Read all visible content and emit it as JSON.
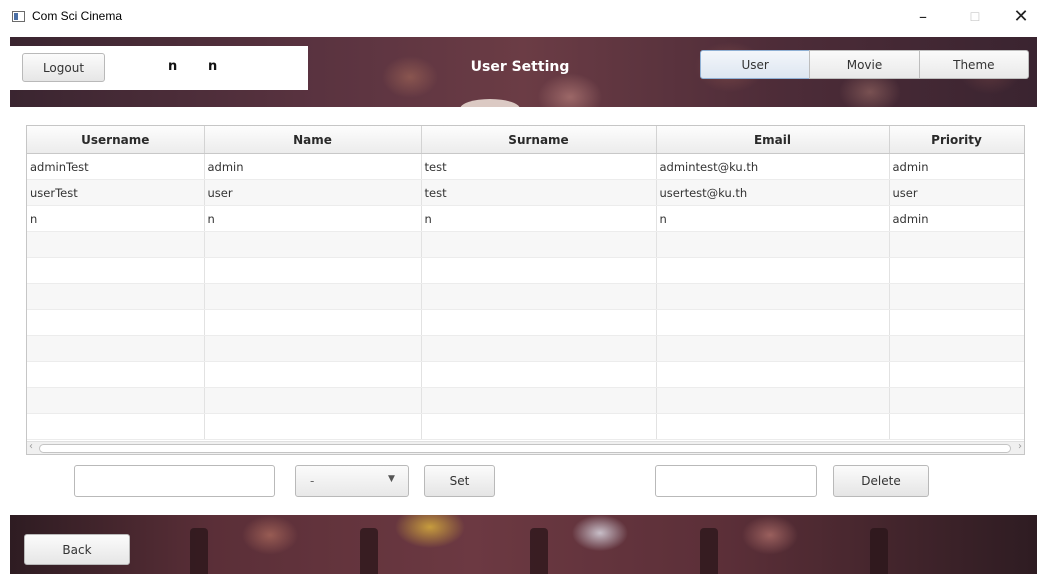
{
  "window": {
    "title": "Com Sci Cinema",
    "min_glyph": "–",
    "max_glyph": "☐",
    "close_glyph": "✕"
  },
  "header": {
    "logout_label": "Logout",
    "user_first": "n",
    "user_last": "n",
    "page_title": "User Setting",
    "tabs": [
      {
        "label": "User",
        "selected": true
      },
      {
        "label": "Movie",
        "selected": false
      },
      {
        "label": "Theme",
        "selected": false
      }
    ]
  },
  "table": {
    "columns": [
      "Username",
      "Name",
      "Surname",
      "Email",
      "Priority"
    ],
    "rows": [
      [
        "adminTest",
        "admin",
        "test",
        "admintest@ku.th",
        "admin"
      ],
      [
        "userTest",
        "user",
        "test",
        "usertest@ku.th",
        "user"
      ],
      [
        "n",
        "n",
        "n",
        "n",
        "admin"
      ]
    ],
    "empty_rows": 8
  },
  "controls": {
    "priority_value": "-",
    "set_label": "Set",
    "delete_label": "Delete"
  },
  "footer": {
    "back_label": "Back"
  },
  "icons": {
    "dropdown_arrow": "▼",
    "scroll_left": "‹",
    "scroll_right": "›"
  },
  "colors": {
    "banner": "#5a3340",
    "selected_tab_border": "#8fb0d4"
  }
}
